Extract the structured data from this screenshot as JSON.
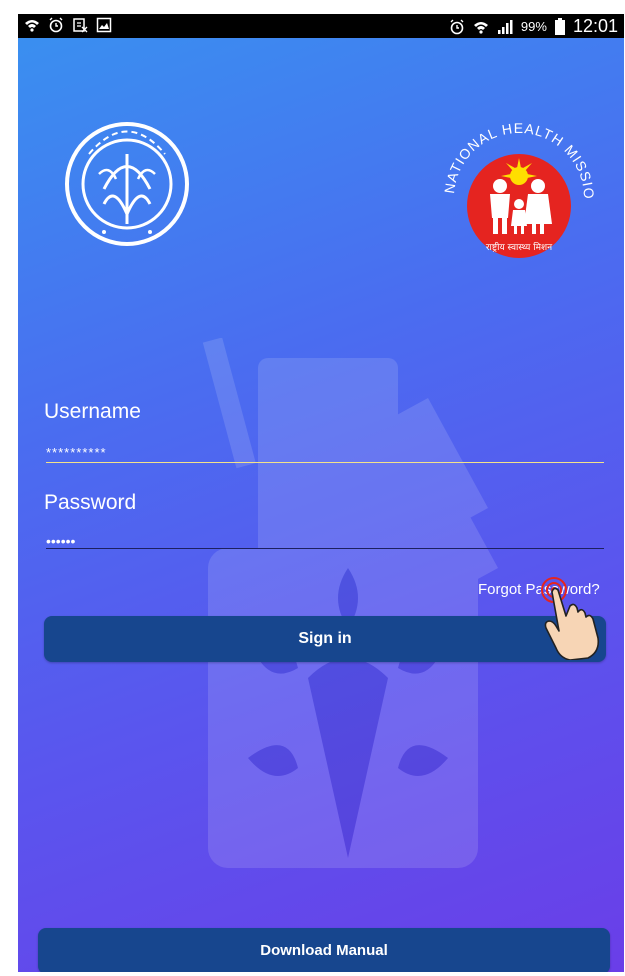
{
  "status_bar": {
    "battery": "99%",
    "time": "12:01",
    "left_icons": [
      "wifi-icon",
      "alarm-icon",
      "clipboard-icon",
      "image-icon"
    ],
    "right_icons": [
      "alarm-icon",
      "wifi-icon",
      "signal-icon",
      "battery-icon"
    ]
  },
  "logos": {
    "left": "up-government-emblem",
    "right_text_arc": "NATIONAL HEALTH MISSION",
    "right_subtitle": "राष्ट्रीय स्वास्थ्य मिशन"
  },
  "form": {
    "username_label": "Username",
    "username_value": "**********",
    "password_label": "Password",
    "password_value": "••••••",
    "forgot_password": "Forgot Password?",
    "sign_in": "Sign in"
  },
  "footer": {
    "download_manual": "Download Manual"
  },
  "colors": {
    "button": "#17468e",
    "gradient_top": "#3a8ff0",
    "gradient_bottom": "#6a3ee8",
    "nhm_red": "#e52420",
    "username_underline": "#f3e28a",
    "password_underline": "#1d2060"
  }
}
